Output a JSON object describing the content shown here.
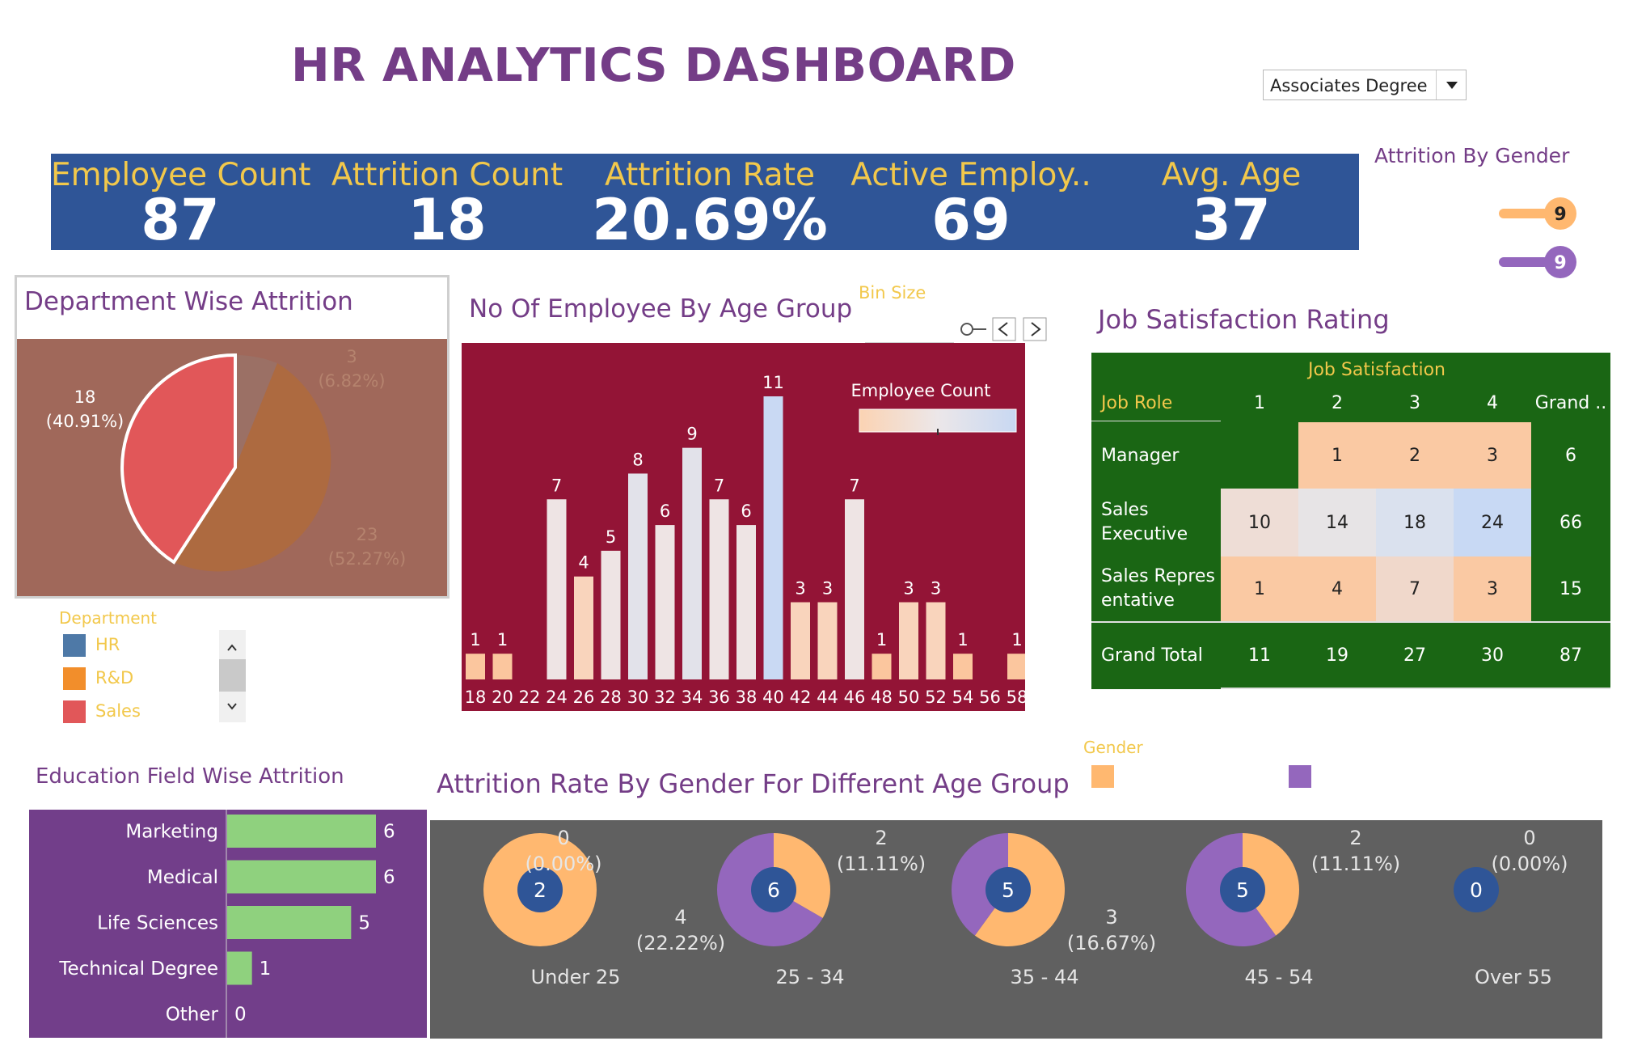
{
  "title": "HR ANALYTICS DASHBOARD",
  "filter": {
    "selected": "Associates Degree"
  },
  "kpis": [
    {
      "label": "Employee Count",
      "value": "87"
    },
    {
      "label": "Attrition Count",
      "value": "18"
    },
    {
      "label": "Attrition Rate",
      "value": "20.69%"
    },
    {
      "label": "Active Employ..",
      "value": "69"
    },
    {
      "label": "Avg. Age",
      "value": "37"
    }
  ],
  "attrition_by_gender": {
    "title": "Attrition By Gender",
    "values": [
      "9",
      "9"
    ],
    "colors": [
      "#FFB870",
      "#9467BD"
    ]
  },
  "department": {
    "title": "Department Wise Attrition",
    "legend_title": "Department",
    "legend": [
      {
        "name": "HR",
        "color": "#4E79A7"
      },
      {
        "name": "R&D",
        "color": "#F28E2B"
      },
      {
        "name": "Sales",
        "color": "#E15759"
      }
    ],
    "labels": [
      {
        "count": "3",
        "pct": "(6.82%)"
      },
      {
        "count": "23",
        "pct": "(52.27%)"
      },
      {
        "count": "18",
        "pct": "(40.91%)"
      }
    ]
  },
  "age_group": {
    "title": "No Of Employee By Age Group",
    "bin_size_label": "Bin Size",
    "legend_title": "Employee Count"
  },
  "job_satisfaction": {
    "title": "Job Satisfaction Rating",
    "col_header": "Job Satisfaction",
    "row_header": "Job Role",
    "columns": [
      "1",
      "2",
      "3",
      "4",
      "Grand .."
    ],
    "rows": [
      {
        "role": "Manager",
        "values": [
          "",
          "1",
          "2",
          "3"
        ],
        "total": "6"
      },
      {
        "role": "Sales Executive",
        "values": [
          "10",
          "14",
          "18",
          "24"
        ],
        "total": "66"
      },
      {
        "role": "Sales Representative",
        "values": [
          "1",
          "4",
          "7",
          "3"
        ],
        "total": "15"
      }
    ],
    "grand_total": {
      "label": "Grand Total",
      "values": [
        "11",
        "19",
        "27",
        "30"
      ],
      "total": "87"
    }
  },
  "education": {
    "title": "Education Field Wise Attrition"
  },
  "gender_age": {
    "title": "Attrition Rate By Gender For Different Age Group",
    "legend_title": "Gender",
    "groups": [
      {
        "label": "Under 25",
        "center": "2",
        "top_count": "0",
        "top_pct": "(0.00%)",
        "side_count": "",
        "side_pct": ""
      },
      {
        "label": "25 - 34",
        "center": "6",
        "top_count": "2",
        "top_pct": "(11.11%)",
        "side_count": "4",
        "side_pct": "(22.22%)"
      },
      {
        "label": "35 - 44",
        "center": "5",
        "top_count": "",
        "top_pct": "",
        "side_count": "3",
        "side_pct": "(16.67%)"
      },
      {
        "label": "45 - 54",
        "center": "5",
        "top_count": "2",
        "top_pct": "(11.11%)",
        "side_count": "",
        "side_pct": ""
      },
      {
        "label": "Over 55",
        "center": "0",
        "top_count": "0",
        "top_pct": "(0.00%)",
        "side_count": "",
        "side_pct": ""
      }
    ]
  },
  "chart_data": [
    {
      "type": "pie",
      "title": "Department Wise Attrition",
      "categories": [
        "HR",
        "R&D",
        "Sales"
      ],
      "values": [
        3,
        23,
        18
      ],
      "percent": [
        6.82,
        52.27,
        40.91
      ]
    },
    {
      "type": "bar",
      "title": "No Of Employee By Age Group",
      "categories": [
        "18",
        "20",
        "22",
        "24",
        "26",
        "28",
        "30",
        "32",
        "34",
        "36",
        "38",
        "40",
        "42",
        "44",
        "46",
        "48",
        "50",
        "52",
        "54",
        "56",
        "58"
      ],
      "values": [
        1,
        1,
        0,
        7,
        4,
        5,
        8,
        6,
        9,
        7,
        6,
        11,
        3,
        3,
        7,
        1,
        3,
        3,
        1,
        0,
        1
      ],
      "legend": "Employee Count"
    },
    {
      "type": "bar",
      "title": "Education Field Wise Attrition",
      "categories": [
        "Marketing",
        "Medical",
        "Life Sciences",
        "Technical Degree",
        "Other"
      ],
      "values": [
        6,
        6,
        5,
        1,
        0
      ],
      "color": "#8FD17E"
    },
    {
      "type": "pie",
      "title": "Attrition Rate By Gender For Different Age Group",
      "categories": [
        "Under 25",
        "25 - 34",
        "35 - 44",
        "45 - 54",
        "Over 55"
      ],
      "totals": [
        2,
        6,
        5,
        5,
        0
      ],
      "series": [
        {
          "color": "#FFB870",
          "values": [
            2,
            2,
            3,
            2,
            0
          ]
        },
        {
          "color": "#9467BD",
          "values": [
            0,
            4,
            2,
            3,
            0
          ]
        }
      ]
    }
  ]
}
